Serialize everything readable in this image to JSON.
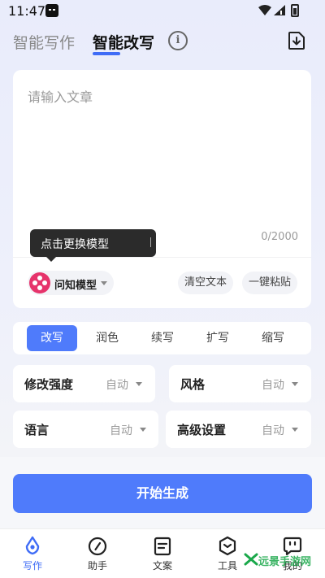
{
  "status_bar": {
    "time": "11:47"
  },
  "header": {
    "tab_write": "智能写作",
    "tab_rewrite": "智能改写",
    "info_icon": "i",
    "download_icon": "download-icon"
  },
  "editor": {
    "placeholder": "请输入文章",
    "char_count": "0/2000"
  },
  "tooltip": {
    "text": "点击更换模型",
    "separator": "|",
    "close": "✕"
  },
  "model": {
    "name": "问知模型",
    "logo_color": "#e6336b"
  },
  "actions": {
    "clear": "清空文本",
    "paste": "一键粘贴"
  },
  "modes": [
    {
      "label": "改写",
      "active": true
    },
    {
      "label": "润色",
      "active": false
    },
    {
      "label": "续写",
      "active": false
    },
    {
      "label": "扩写",
      "active": false
    },
    {
      "label": "缩写",
      "active": false
    }
  ],
  "settings": [
    {
      "label": "修改强度",
      "value": "自动"
    },
    {
      "label": "风格",
      "value": "自动"
    },
    {
      "label": "语言",
      "value": "自动"
    },
    {
      "label": "高级设置",
      "value": "自动"
    }
  ],
  "start_button": "开始生成",
  "nav": [
    {
      "label": "写作",
      "icon": "pen-nib-icon",
      "active": true
    },
    {
      "label": "助手",
      "icon": "compass-icon",
      "active": false
    },
    {
      "label": "文案",
      "icon": "document-icon",
      "active": false
    },
    {
      "label": "工具",
      "icon": "hexagon-tool-icon",
      "active": false
    },
    {
      "label": "我的",
      "icon": "chat-face-icon",
      "active": false
    }
  ],
  "watermark": {
    "text": "远景手游网",
    "color": "#1aa84a"
  },
  "colors": {
    "accent": "#4f7bfb",
    "tab_underline": "#3f6cf6",
    "tooltip_bg": "#2b2b2b"
  }
}
